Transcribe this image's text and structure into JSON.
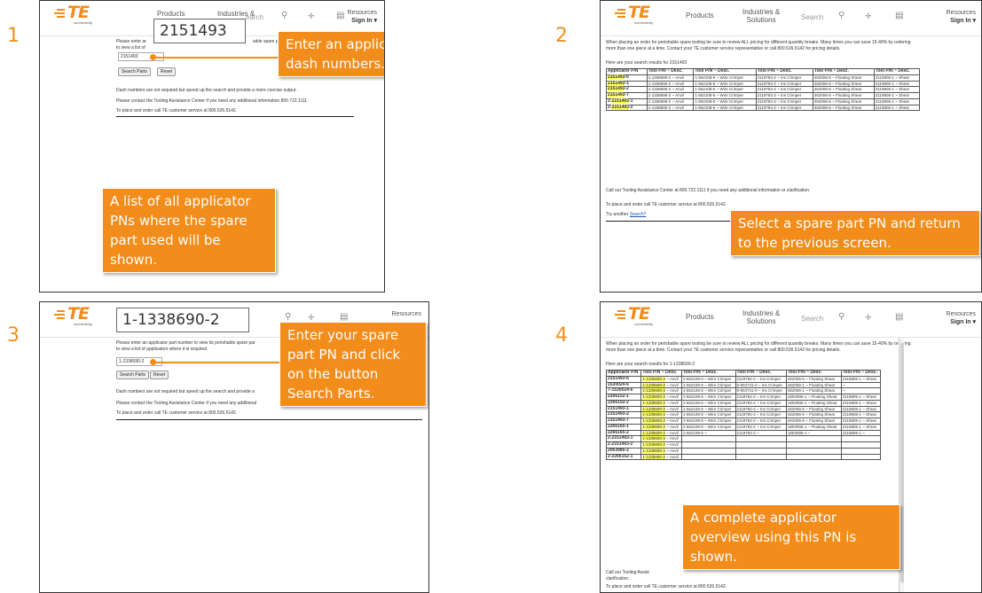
{
  "steps": [
    "1",
    "2",
    "3",
    "4"
  ],
  "header": {
    "logo_text": "TE",
    "logo_sub": "connectivity",
    "nav_products": "Products",
    "nav_industries_1": "Industries &",
    "nav_industries_2": "Solutions",
    "search_placeholder": "Search",
    "search_partial": "earch",
    "resources": "Resources",
    "sign_in": "Sign In ▾",
    "icons": [
      "search-icon",
      "cart-icon",
      "list-icon"
    ]
  },
  "screen1": {
    "zoom_value": "2151493",
    "intro_partial_1": "Please enter ar",
    "intro_partial_2": "to view a list of",
    "intro_tail_1": "iable spare pa",
    "input_value": "2151493",
    "search_btn": "Search Parts",
    "reset_btn": "Reset",
    "line1": "Dash numbers are not required but speed up the search and provide a more concise output.",
    "line2": "Please contact the Tooling Assistance Center if you need any additional information 800.722.1111.",
    "line3": "To place and order call TE customer service at 800.526.5142.",
    "callout_top": "Enter an applicator PN without dash numbers.",
    "callout_bottom": "A list of all applicator PNs where the spare part used will be shown."
  },
  "screen2": {
    "intro": "When placing an order for perishable spare tooling be sure to review ALL pricing for different quantity breaks. Many times you can save 15-40% by ordering more than one piece at a time. Contact your TE customer service representative or call 800.526.5142 for pricing details.",
    "results_label": "Here are your search results for 2151493",
    "headers": [
      "Applicator P/N",
      "Tool P/N ~ Desc.",
      "Tool P/N ~ Desc.",
      "Tool P/N ~ Desc.",
      "Tool P/N ~ Desc.",
      "Tool P/N ~ Desc."
    ],
    "rows": [
      {
        "pre": "",
        "hl": "2151493",
        "post": "-6",
        "cells": [
          "1-1338690-2 ~ Anvil",
          "1-562108-5 ~ Wire Crimper",
          "2119784-2 ~ Ins Crimper",
          "462006-6 ~ Floating Shear",
          "2119806-1 ~ Shear"
        ]
      },
      {
        "pre": "",
        "hl": "2151493",
        "post": "-1",
        "cells": [
          "1-1338690-2 ~ Anvil",
          "1-562108-5 ~ Wire Crimper",
          "2119784-2 ~ Ins Crimper",
          "462006-6 ~ Floating Shear",
          "2119806-1 ~ Shear"
        ]
      },
      {
        "pre": "",
        "hl": "2151493",
        "post": "-2",
        "cells": [
          "1-1338690-2 ~ Anvil",
          "1-562108-5 ~ Wire Crimper",
          "2119784-2 ~ Ins Crimper",
          "462006-6 ~ Floating Shear",
          "2119806-1 ~ Shear"
        ]
      },
      {
        "pre": "",
        "hl": "2151493",
        "post": "-7",
        "cells": [
          "1-1338690-2 ~ Anvil",
          "1-562108-5 ~ Wire Crimper",
          "2119784-2 ~ Ins Crimper",
          "462006-6 ~ Floating Shear",
          "2119806-1 ~ Shear"
        ]
      },
      {
        "pre": "2-",
        "hl": "2151493",
        "post": "-1",
        "cells": [
          "1-1338690-2 ~ Anvil",
          "1-562108-5 ~ Wire Crimper",
          "2119784-2 ~ Ins Crimper",
          "462006-6 ~ Floating Shear",
          "2119806-1 ~ Shear"
        ]
      },
      {
        "pre": "2-",
        "hl": "2151493",
        "post": "-2",
        "cells": [
          "1-1338690-2 ~ Anvil",
          "1-562108-5 ~ Wire Crimper",
          "2119784-2 ~ Ins Crimper",
          "462006-6 ~ Floating Shear",
          "2119806-1 ~ Shear"
        ]
      }
    ],
    "footer1": "Call our Tooling Assistance Center at 800.722.1111 if you need any additional information or clarification.",
    "footer2": "To place and order call TE customer service at 800.526.5142.",
    "try_text": "Try another",
    "try_link": "Search?",
    "callout": "Select a spare part PN and return to the previous screen."
  },
  "screen3": {
    "zoom_value": "1-1338690-2",
    "intro_1": "Please enter an applicator part number to view its perishable spare par",
    "intro_2": "to view a list of applicators where it is required.",
    "input_value": "1-1338690-2",
    "search_btn": "Search Parts",
    "reset_btn": "Reset",
    "line1": "Dash numbers are not required but speed up the search and provide a",
    "line2": "Please contact the Tooling Assistance Center if you need any additional",
    "line3": "To place and order call TE customer service at 800.526.5142.",
    "callout": "Enter your spare part PN and click on the button Search Parts."
  },
  "screen4": {
    "intro": "When placing an order for perishable spare tooling be sure to review ALL pricing for different quantity breaks. Many times you can save 15-40% by ordering more than one piece at a time. Contact your TE customer service representative or call 800.526.5142 for pricing details.",
    "results_label": "Here are your search results for 1-1338690-2",
    "headers": [
      "Applicator P/N",
      "Tool P/N ~ Desc.",
      "Tool P/N ~ Desc.",
      "Tool P/N ~ Desc.",
      "Tool P/N ~ Desc.",
      "Tool P/N ~ Desc."
    ],
    "hl_part": "1-1338690-2",
    "rows": [
      {
        "app": "2151493-6",
        "cells": [
          "1-562108-5 ~ Wire Crimper",
          "2119784-2 ~ Ins Crimper",
          "462006-6 ~ Floating Shear",
          "2119806-1 ~ Shear"
        ]
      },
      {
        "app": "1530024-6",
        "cells": [
          "1-562108-5 ~ Wire Crimper",
          "8-904741-0 ~ Ins Crimper",
          "462006-1 ~ Floating Shear",
          "~"
        ]
      },
      {
        "app": "7-1530024-6",
        "cells": [
          "1-562108-5 ~ Wire Crimper",
          "8-904741-0 ~ Ins Crimper",
          "462006-1 ~ Floating Shear",
          "~"
        ]
      },
      {
        "app": "2266152-1",
        "cells": [
          "1-562108-5 ~ Wire Crimper",
          "2119784-2 ~ Ins Crimper",
          "1803095-1 ~ Floating Shear",
          "2119806-1 ~ Shear"
        ]
      },
      {
        "app": "2266152-2",
        "cells": [
          "1-562108-5 ~ Wire Crimper",
          "2119784-2 ~ Ins Crimper",
          "1803095-1 ~ Floating Shear",
          "2119806-1 ~ Shear"
        ]
      },
      {
        "app": "2151493-1",
        "cells": [
          "1-562108-5 ~ Wire Crimper",
          "2119784-2 ~ Ins Crimper",
          "462006-6 ~ Floating Shear",
          "2119806-1 ~ Shear"
        ]
      },
      {
        "app": "2151493-2",
        "cells": [
          "1-562108-5 ~ Wire Crimper",
          "2119784-2 ~ Ins Crimper",
          "462006-6 ~ Floating Shear",
          "2119806-1 ~ Shear"
        ]
      },
      {
        "app": "2151493-7",
        "cells": [
          "1-562108-5 ~ Wire Crimper",
          "2119784-2 ~ Ins Crimper",
          "462006-6 ~ Floating Shear",
          "2119806-1 ~ Shear"
        ]
      },
      {
        "app": "2266165-1",
        "cells": [
          "1-562108-5 ~ Wire Crimper",
          "2119784-2 ~ Ins Crimper",
          "1803095-1 ~ Floating Shear",
          "2119806-1 ~ Shear"
        ]
      },
      {
        "app": "2266165-2",
        "cells": [
          "1-562108-5 ~",
          "2119784-2 ~",
          "1803095-1 ~",
          "2119806-1 ~"
        ]
      },
      {
        "app": "2-2151493-1",
        "cells": [
          "",
          "",
          "",
          ""
        ]
      },
      {
        "app": "2-2151493-2",
        "cells": [
          "",
          "",
          "",
          ""
        ]
      },
      {
        "app": "2063985-2",
        "cells": [
          "",
          "",
          "",
          ""
        ]
      },
      {
        "app": "2-2266152-1",
        "cells": [
          "",
          "",
          "",
          ""
        ]
      }
    ],
    "footer1": "Call our Tooling Assist",
    "footer1b": "clarification.",
    "footer2": "To place and order call TE customer service at 800.526.5142.",
    "callout": "A complete applicator overview using this PN is shown."
  },
  "colors": {
    "accent": "#f28c1b",
    "highlight": "#ffff66",
    "border": "#333333"
  }
}
